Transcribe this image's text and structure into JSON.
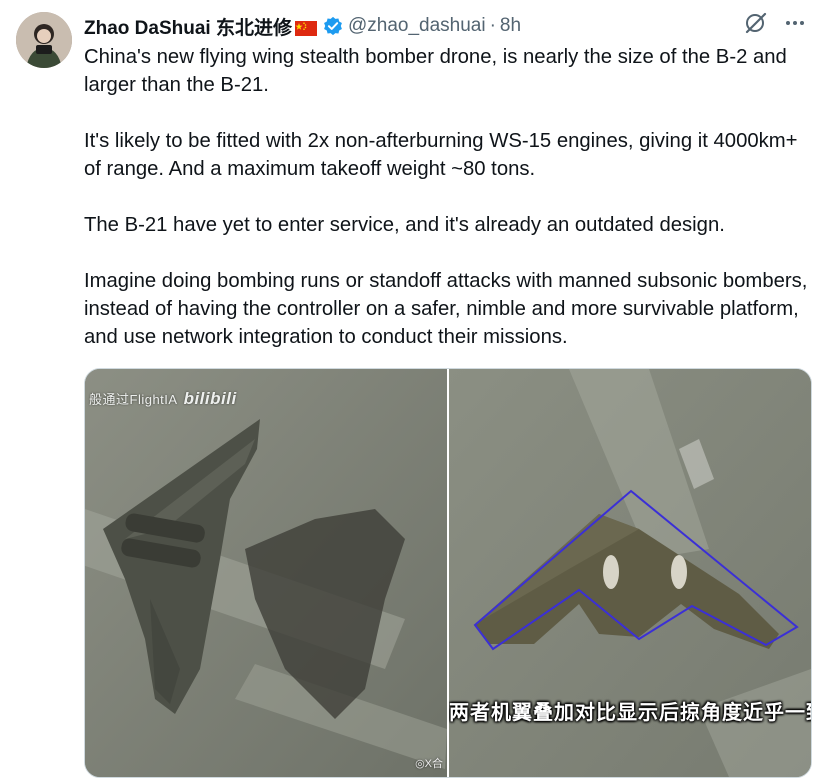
{
  "author": {
    "name": "Zhao DaShuai 东北进修",
    "flag_icon": "china-flag-icon",
    "verified_icon": "verified-badge-icon",
    "handle": "@zhao_dashuai",
    "separator": "·",
    "time": "8h"
  },
  "actions": {
    "grok_icon": "grok-icon",
    "more_icon": "more-icon"
  },
  "tweet": {
    "paragraphs": [
      "China's new flying wing stealth bomber drone, is nearly the size of the B-2 and larger than the B-21.",
      "It's likely to be fitted with 2x non-afterburning WS-15 engines, giving it 4000km+ of range. And a maximum takeoff weight ~80 tons.",
      "The B-21 have yet to enter service, and it's already an outdated design.",
      "Imagine doing bombing runs or standoff attacks with manned subsonic bombers, instead of having the controller on a safer, nimble and more survivable platform, and use network integration to conduct their missions."
    ]
  },
  "media": {
    "left": {
      "watermark": "般通过FlightIA",
      "watermark_brand": "bilibili",
      "credit": "◎X合"
    },
    "right": {
      "caption": "两者机翼叠加对比显示后掠角度近乎一致"
    }
  },
  "colors": {
    "text": "#0f1419",
    "muted": "#536471",
    "verified": "#1d9bf0",
    "outline": "#3b2fd6"
  }
}
